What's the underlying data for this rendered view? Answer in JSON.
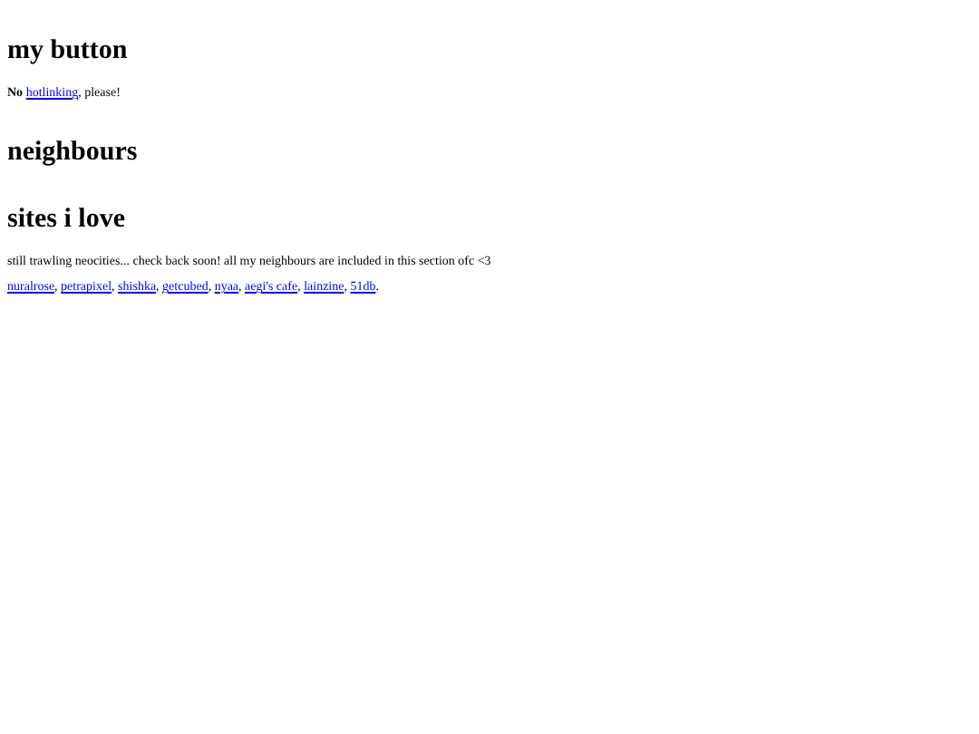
{
  "sections": [
    {
      "heading": "my button",
      "paragraphs": [
        [
          {
            "kind": "bold",
            "text": "No "
          },
          {
            "kind": "link",
            "text": "hotlinking"
          },
          {
            "kind": "text",
            "text": ", please!"
          }
        ]
      ]
    },
    {
      "heading": "neighbours"
    },
    {
      "heading": "sites i love",
      "paragraphs": [
        [
          {
            "kind": "text",
            "text": "still trawling neocities... check back soon! all my neighbours are included in this section ofc <3"
          }
        ],
        [
          {
            "kind": "link",
            "text": "nuralrose"
          },
          {
            "kind": "text",
            "text": ", "
          },
          {
            "kind": "link",
            "text": "petrapixel"
          },
          {
            "kind": "text",
            "text": ", "
          },
          {
            "kind": "link",
            "text": "shishka"
          },
          {
            "kind": "text",
            "text": ", "
          },
          {
            "kind": "link",
            "text": "getcubed"
          },
          {
            "kind": "text",
            "text": ", "
          },
          {
            "kind": "link",
            "text": "nyaa"
          },
          {
            "kind": "text",
            "text": ", "
          },
          {
            "kind": "link",
            "text": "aegi's cafe"
          },
          {
            "kind": "text",
            "text": ", "
          },
          {
            "kind": "link",
            "text": "lainzine"
          },
          {
            "kind": "text",
            "text": ", "
          },
          {
            "kind": "link",
            "text": "51db"
          },
          {
            "kind": "text",
            "text": "."
          }
        ]
      ]
    }
  ]
}
